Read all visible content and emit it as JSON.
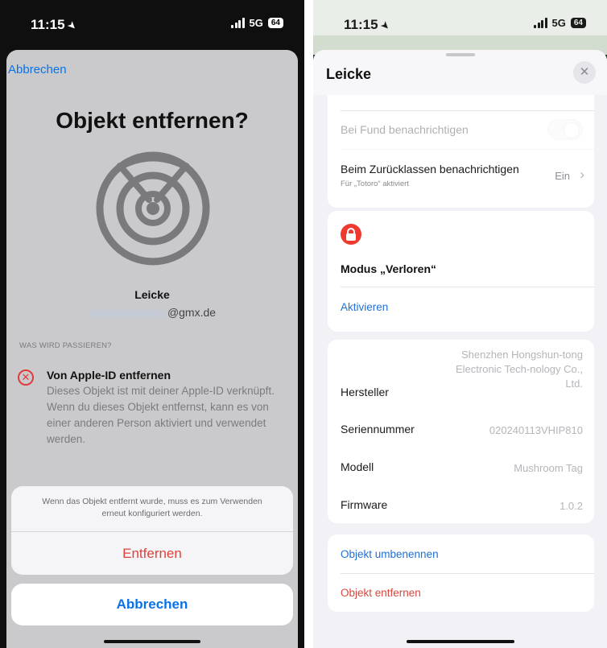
{
  "left": {
    "status": {
      "time": "11:15",
      "network": "5G",
      "battery": "64"
    },
    "cancel_link": "Abbrechen",
    "title": "Objekt entfernen?",
    "device_name": "Leicke",
    "email_suffix": "@gmx.de",
    "section_label": "WAS WIRD PASSIEREN?",
    "remove_title": "Von Apple-ID entfernen",
    "remove_body": "Dieses Objekt ist mit deiner Apple-ID verknüpft. Wenn du dieses Objekt entfernst, kann es von einer anderen Person aktiviert und verwendet werden.",
    "action_message": "Wenn das Objekt entfernt wurde, muss es zum Verwenden erneut konfiguriert werden.",
    "action_remove": "Entfernen",
    "action_cancel": "Abbrechen",
    "colors": {
      "accent": "#0a72e8",
      "destructive": "#e0413b"
    }
  },
  "right": {
    "status": {
      "time": "11:15",
      "network": "5G",
      "battery": "64"
    },
    "title": "Leicke",
    "notify_found": {
      "label": "Bei Fund benachrichtigen",
      "enabled": false
    },
    "notify_left": {
      "label": "Beim Zurücklassen benachrichtigen",
      "sub": "Für „Totoro“ aktiviert",
      "value": "Ein"
    },
    "lost_mode": {
      "title": "Modus „Verloren“",
      "action": "Aktivieren"
    },
    "info": [
      {
        "label": "Hersteller",
        "value": "Shenzhen Hongshun-tong Electronic Tech-nology Co., Ltd."
      },
      {
        "label": "Seriennummer",
        "value": "020240113VHIP810"
      },
      {
        "label": "Modell",
        "value": "Mushroom Tag"
      },
      {
        "label": "Firmware",
        "value": "1.0.2"
      }
    ],
    "actions": {
      "rename": "Objekt umbenennen",
      "remove": "Objekt entfernen"
    },
    "colors": {
      "lock_badge": "#ee3a2f",
      "link": "#1f6fd6",
      "destructive": "#d9463b"
    }
  }
}
